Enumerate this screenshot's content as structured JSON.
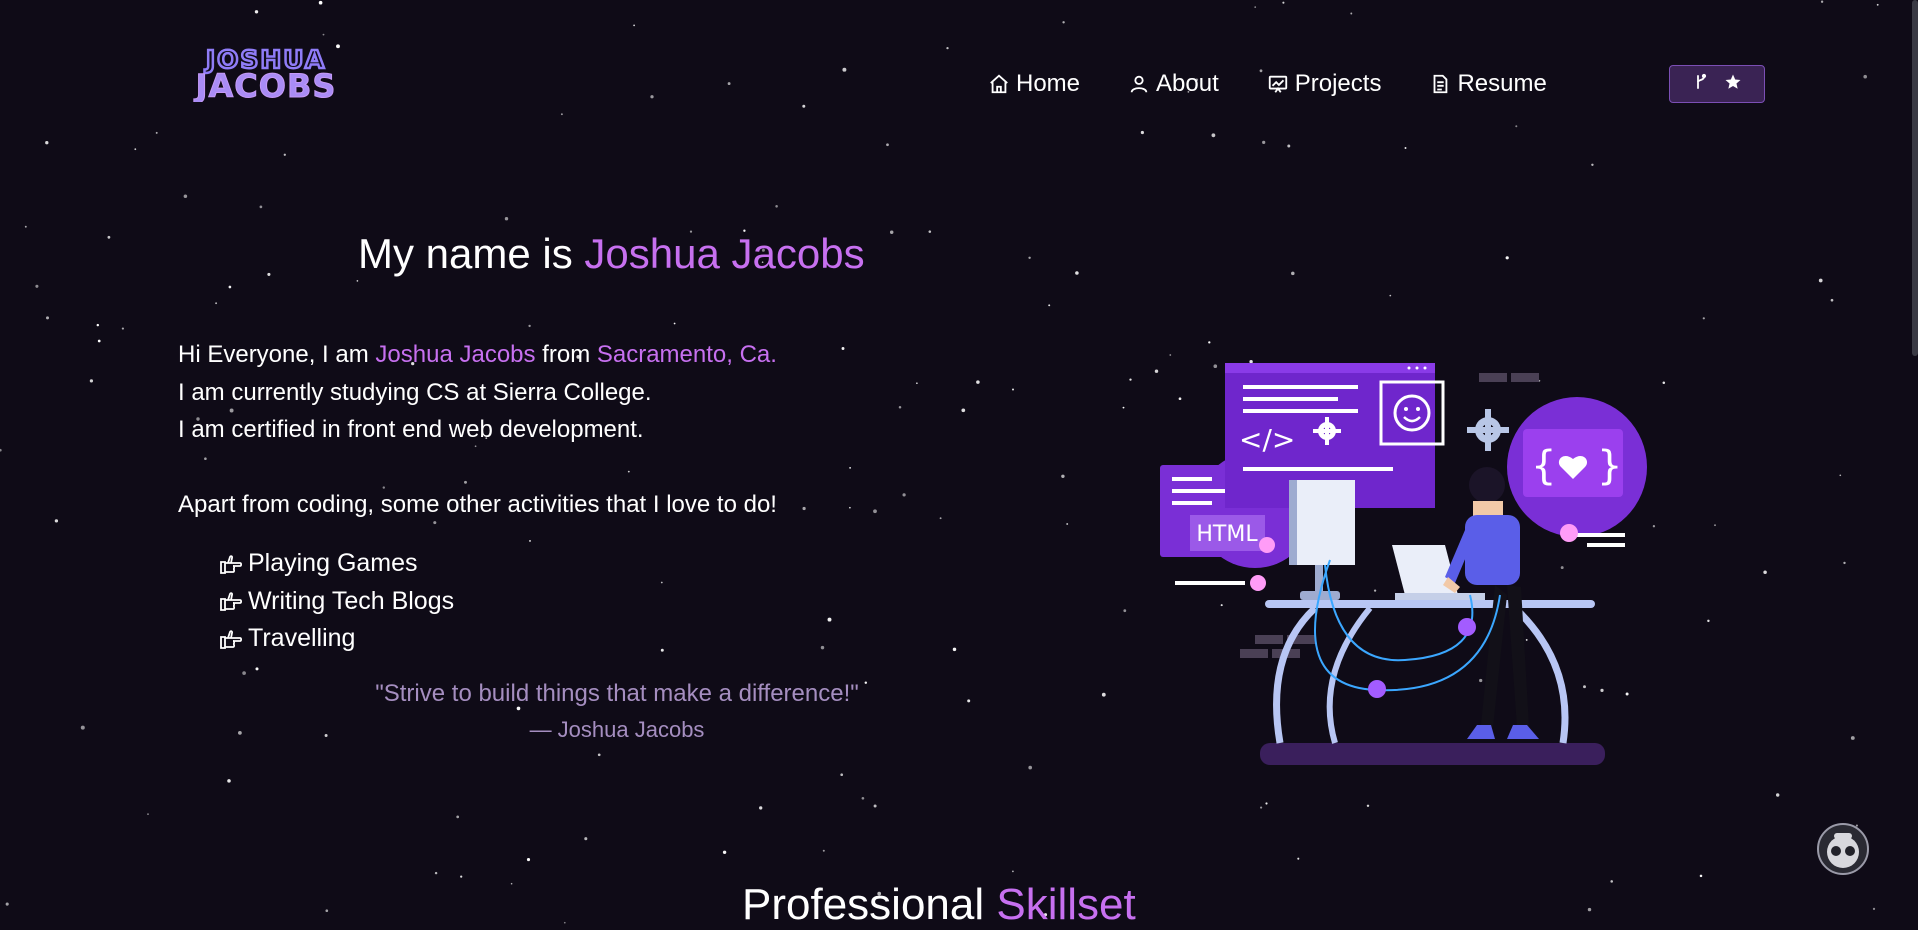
{
  "logo": {
    "line1": "JOSHUA",
    "line2": "JACOBS",
    "color": "#8f7cf7"
  },
  "nav": {
    "items": [
      {
        "label": "Home",
        "icon": "home-icon"
      },
      {
        "label": "About",
        "icon": "user-icon"
      },
      {
        "label": "Projects",
        "icon": "projects-icon"
      },
      {
        "label": "Resume",
        "icon": "document-icon"
      }
    ],
    "repo_button": {
      "icons": [
        "fork-icon",
        "star-icon"
      ]
    }
  },
  "hero": {
    "title_prefix": "My name is ",
    "title_name": "Joshua Jacobs",
    "intro": {
      "l1_a": "Hi Everyone, I am ",
      "l1_name": "Joshua Jacobs",
      "l1_b": " from ",
      "l1_place": "Sacramento, Ca.",
      "l2": "I am currently studying CS at Sierra College.",
      "l3": "I am certified in front end web development.",
      "l4": "Apart from coding, some other activities that I love to do!"
    },
    "hobbies": [
      "Playing Games",
      "Writing Tech Blogs",
      "Travelling"
    ],
    "quote": "\"Strive to build things that make a difference!\"",
    "quote_author": "— Joshua Jacobs"
  },
  "illustration": {
    "badge_text": "HTML",
    "code_symbol": "</>",
    "braces": "{",
    "braces_close": "}"
  },
  "skills": {
    "heading_a": "Professional ",
    "heading_b": "Skillset"
  },
  "colors": {
    "background": "#0f0b17",
    "accent": "#c770f0",
    "quote": "#a58ec0",
    "button_bg": "#3a2354",
    "illustration_purple": "#7a2fd6"
  }
}
